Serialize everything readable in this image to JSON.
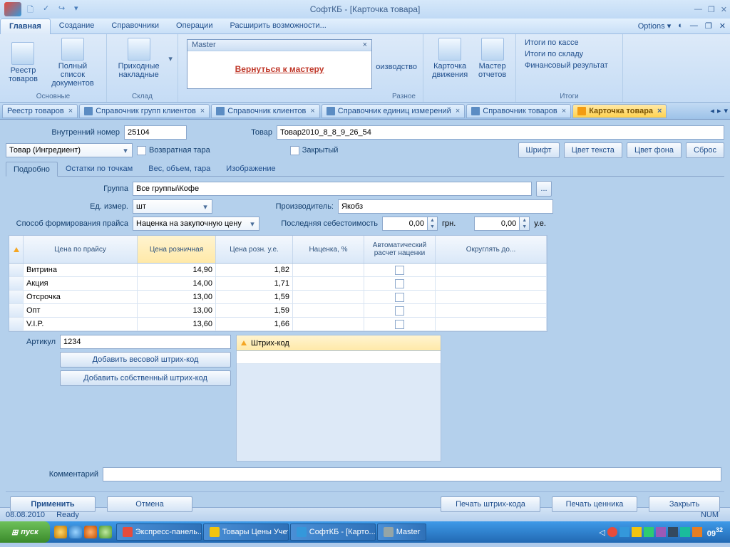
{
  "app": {
    "title": "СофтКБ - [Карточка товара]"
  },
  "menu": {
    "active": "Главная",
    "items": [
      "Главная",
      "Создание",
      "Справочники",
      "Операции",
      "Расширить возможности..."
    ],
    "options": "Options"
  },
  "ribbon": {
    "g1": {
      "label": "Основные",
      "btn1": "Реестр товаров",
      "btn2": "Полный список документов"
    },
    "g2": {
      "label": "Склад",
      "btn1": "Приходные накладные"
    },
    "g3": {
      "label": "Разное",
      "prod": "оизводство"
    },
    "g4": {
      "btn1": "Карточка движения",
      "btn2": "Мастер отчетов"
    },
    "g5": {
      "label": "Итоги",
      "l1": "Итоги по кассе",
      "l2": "Итоги по складу",
      "l3": "Финансовый результат"
    },
    "master": {
      "title": "Master",
      "link": "Вернуться к мастеру"
    }
  },
  "doctabs": [
    {
      "label": "Реестр товаров"
    },
    {
      "label": "Справочник групп клиентов"
    },
    {
      "label": "Справочник клиентов"
    },
    {
      "label": "Справочник единиц измерений"
    },
    {
      "label": "Справочник товаров"
    },
    {
      "label": "Карточка товара",
      "active": true
    }
  ],
  "form": {
    "internal_no_label": "Внутренний номер",
    "internal_no": "25104",
    "name_label": "Товар",
    "name": "Товар2010_8_8_9_26_54",
    "type": "Товар (Ингредиент)",
    "return_label": "Возвратная тара",
    "closed_label": "Закрытый",
    "btn_font": "Шрифт",
    "btn_textcolor": "Цвет текста",
    "btn_bgcolor": "Цвет фона",
    "btn_reset": "Сброс",
    "subtabs": [
      "Подробно",
      "Остатки по точкам",
      "Вес, объем, тара",
      "Изображение"
    ],
    "group_label": "Группа",
    "group": "Все группы\\Кофе",
    "unit_label": "Ед. измер.",
    "unit": "шт",
    "manuf_label": "Производитель:",
    "manuf": "Якобз",
    "price_method_label": "Способ формирования прайса",
    "price_method": "Наценка на закупочную цену",
    "last_cost_label": "Последняя себестоимость",
    "last_cost": "0,00",
    "last_cost_ccy": "грн.",
    "last_cost2": "0,00",
    "last_cost2_ccy": "у.е.",
    "grid_headers": [
      "Цена по прайсу",
      "Цена розничная",
      "Цена розн. у.е.",
      "Наценка, %",
      "Автоматический расчет наценки",
      "Округлять до..."
    ],
    "grid_rows": [
      {
        "name": "Витрина",
        "retail": "14,90",
        "retail_ue": "1,82"
      },
      {
        "name": "Акция",
        "retail": "14,00",
        "retail_ue": "1,71"
      },
      {
        "name": "Отсрочка",
        "retail": "13,00",
        "retail_ue": "1,59"
      },
      {
        "name": "Опт",
        "retail": "13,00",
        "retail_ue": "1,59"
      },
      {
        "name": "V.I.P.",
        "retail": "13,60",
        "retail_ue": "1,66"
      }
    ],
    "article_label": "Артикул",
    "article": "1234",
    "btn_add_weight": "Добавить весовой штрих-код",
    "btn_add_own": "Добавить собственный штрих-код",
    "barcode_header": "Штрих-код",
    "comment_label": "Комментарий",
    "btn_apply": "Применить",
    "btn_cancel": "Отмена",
    "btn_print_bc": "Печать штрих-кода",
    "btn_print_tag": "Печать ценника",
    "btn_close": "Закрыть"
  },
  "status": {
    "date": "08.08.2010",
    "state": "Ready",
    "num": "NUM"
  },
  "taskbar": {
    "start": "пуск",
    "tasks": [
      "Экспресс-панель...",
      "Товары Цены Учет",
      "СофтКБ - [Карто...",
      "Master"
    ],
    "time": "09",
    "time_s": "32"
  }
}
